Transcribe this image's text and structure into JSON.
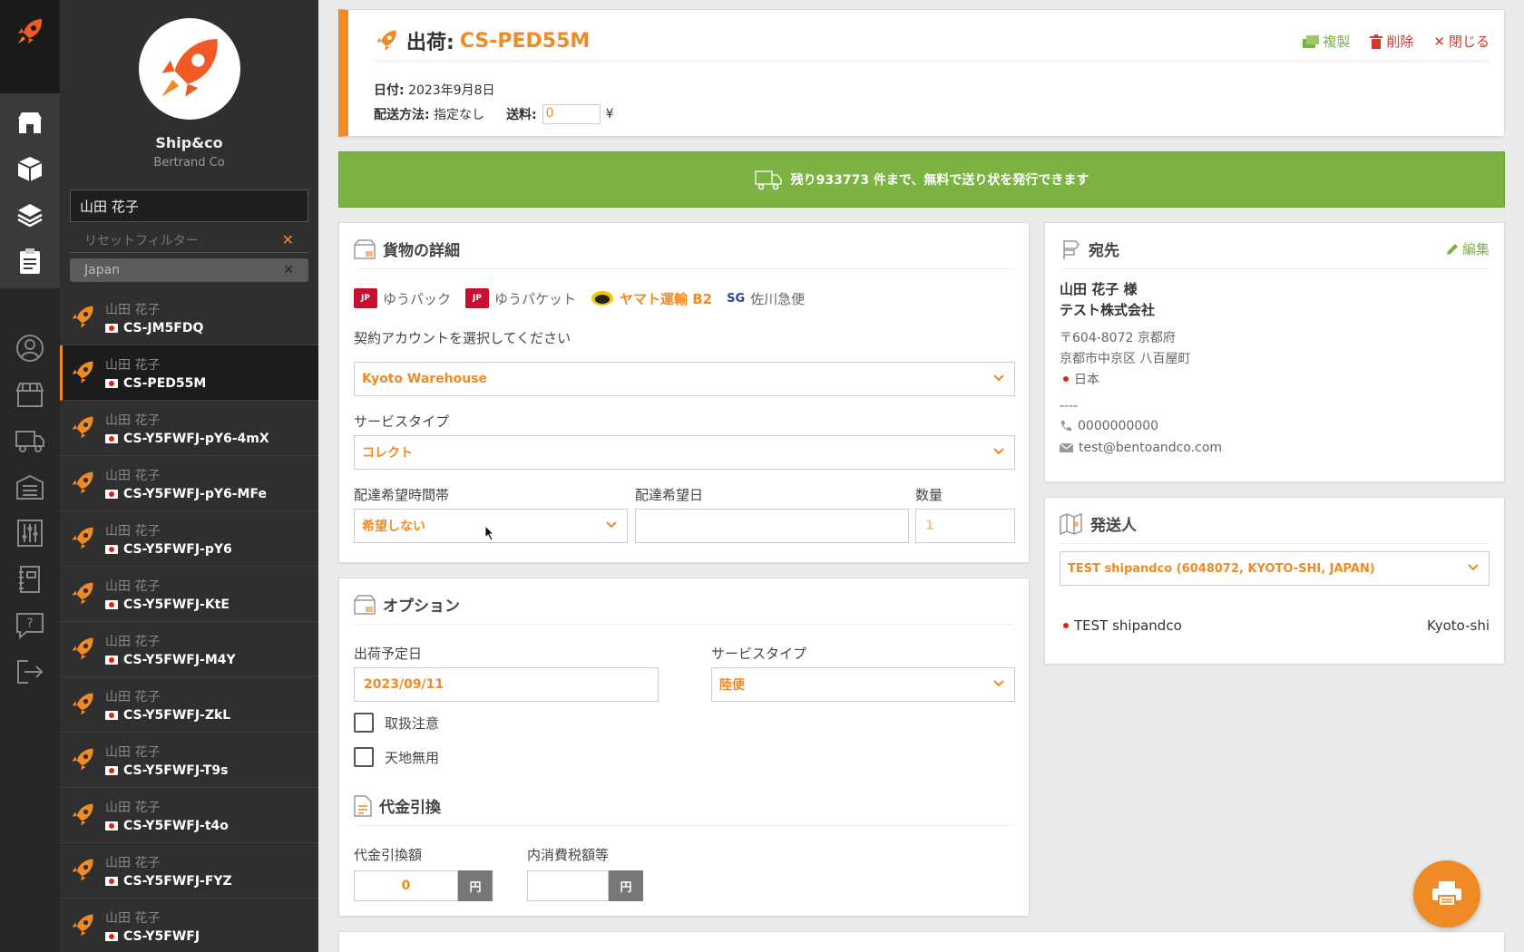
{
  "brand": {
    "name": "Ship&co",
    "company": "Bertrand Co"
  },
  "sidebar": {
    "search_value": "山田 花子",
    "reset_label": "リセットフィルター",
    "filter_chip": "Japan",
    "orders": [
      {
        "name": "山田 花子",
        "id": "CS-JM5FDQ"
      },
      {
        "name": "山田 花子",
        "id": "CS-PED55M",
        "active": true
      },
      {
        "name": "山田 花子",
        "id": "CS-Y5FWFJ-pY6-4mX"
      },
      {
        "name": "山田 花子",
        "id": "CS-Y5FWFJ-pY6-MFe"
      },
      {
        "name": "山田 花子",
        "id": "CS-Y5FWFJ-pY6"
      },
      {
        "name": "山田 花子",
        "id": "CS-Y5FWFJ-KtE"
      },
      {
        "name": "山田 花子",
        "id": "CS-Y5FWFJ-M4Y"
      },
      {
        "name": "山田 花子",
        "id": "CS-Y5FWFJ-ZkL"
      },
      {
        "name": "山田 花子",
        "id": "CS-Y5FWFJ-T9s"
      },
      {
        "name": "山田 花子",
        "id": "CS-Y5FWFJ-t4o"
      },
      {
        "name": "山田 花子",
        "id": "CS-Y5FWFJ-FYZ"
      },
      {
        "name": "山田 花子",
        "id": "CS-Y5FWFJ"
      }
    ]
  },
  "header": {
    "title_prefix": "出荷:",
    "order_id": "CS-PED55M",
    "actions": {
      "duplicate": "複製",
      "delete": "削除",
      "close": "閉じる"
    },
    "date_label": "日付:",
    "date_value": "2023年9月8日",
    "method_label": "配送方法:",
    "method_value": "指定なし",
    "fee_label": "送料:",
    "fee_value": "0",
    "currency": "¥"
  },
  "banner": {
    "text": "残り933773 件まで、無料で送り状を発行できます"
  },
  "cargo": {
    "title": "貨物の詳細",
    "carriers": [
      {
        "badge": "JP",
        "label": "ゆうパック"
      },
      {
        "badge": "JP",
        "label": "ゆうパケット"
      },
      {
        "label": "ヤマト運輸 B2",
        "active": true
      },
      {
        "badge": "SG",
        "label": "佐川急便"
      }
    ],
    "account_label": "契約アカウントを選択してください",
    "account_value": "Kyoto Warehouse",
    "service_label": "サービスタイプ",
    "service_value": "コレクト",
    "time_label": "配達希望時間帯",
    "time_value": "希望しない",
    "date_label": "配達希望日",
    "date_value": "",
    "qty_label": "数量",
    "qty_value": "1"
  },
  "options": {
    "title": "オプション",
    "ship_date_label": "出荷予定日",
    "ship_date_value": "2023/09/11",
    "service_label": "サービスタイプ",
    "service_value": "陸便",
    "fragile": "取扱注意",
    "this_side_up": "天地無用",
    "cod_title": "代金引換",
    "cod_amount_label": "代金引換額",
    "cod_amount_value": "0",
    "tax_label": "内消費税額等",
    "tax_value": "",
    "unit": "円"
  },
  "destination": {
    "title": "宛先",
    "edit": "編集",
    "name": "山田 花子 様",
    "company": "テスト株式会社",
    "postal": "〒604-8072 京都府",
    "address": "京都市中京区 八百屋町",
    "country": "日本",
    "divider": "----",
    "phone": "0000000000",
    "email": "test@bentoandco.com"
  },
  "sender": {
    "title": "発送人",
    "select_value": "TEST shipandco (6048072, KYOTO-SHI, JAPAN)",
    "name": "TEST shipandco",
    "city": "Kyoto-shi"
  },
  "colors": {
    "accent": "#f08a24",
    "success": "#7db343",
    "delete": "#d9362b"
  }
}
